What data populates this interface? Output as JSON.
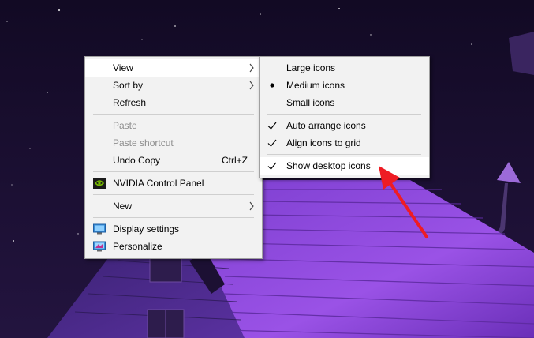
{
  "context_menu": {
    "items": [
      {
        "label": "View",
        "has_submenu": true,
        "highlighted": true
      },
      {
        "label": "Sort by",
        "has_submenu": true
      },
      {
        "label": "Refresh"
      },
      {
        "label": "Paste",
        "disabled": true
      },
      {
        "label": "Paste shortcut",
        "disabled": true
      },
      {
        "label": "Undo Copy",
        "shortcut": "Ctrl+Z"
      },
      {
        "label": "NVIDIA Control Panel",
        "icon": "nvidia-icon"
      },
      {
        "label": "New",
        "has_submenu": true
      },
      {
        "label": "Display settings",
        "icon": "display-settings-icon"
      },
      {
        "label": "Personalize",
        "icon": "personalize-icon"
      }
    ]
  },
  "view_submenu": {
    "items": [
      {
        "label": "Large icons"
      },
      {
        "label": "Medium icons",
        "mark": "bullet"
      },
      {
        "label": "Small icons"
      },
      {
        "label": "Auto arrange icons",
        "mark": "check"
      },
      {
        "label": "Align icons to grid",
        "mark": "check"
      },
      {
        "label": "Show desktop icons",
        "mark": "check",
        "highlighted": true
      }
    ]
  },
  "annotation": {
    "type": "red-arrow",
    "color": "#ee1c24",
    "points_to": "Show desktop icons"
  },
  "colors": {
    "menu_background": "#f2f2f2",
    "menu_highlight": "#ffffff",
    "disabled_text": "#8d8d8d",
    "sky": "#170e2e",
    "roof": "#8a46d6"
  }
}
